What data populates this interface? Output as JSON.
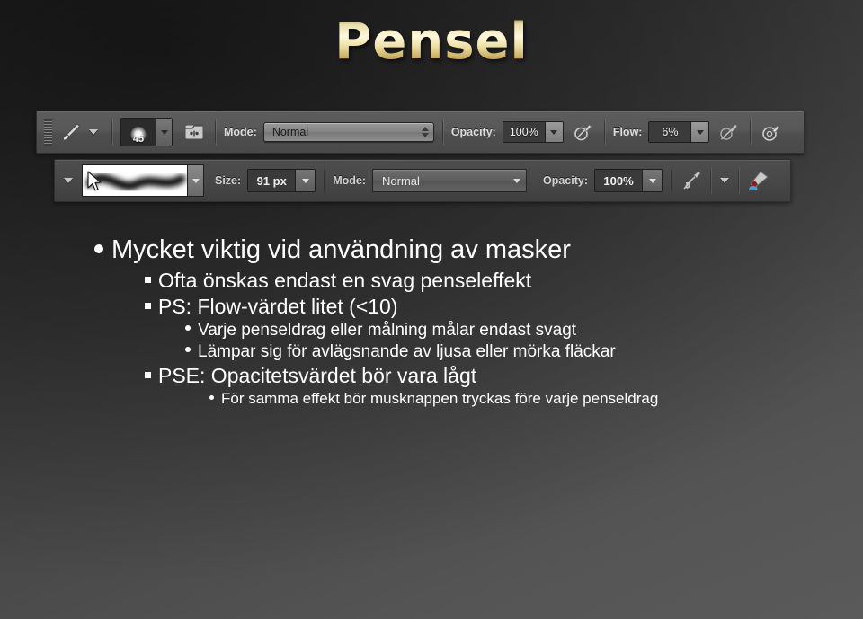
{
  "slide": {
    "title": "Pensel",
    "background_top": "#2a2a2a",
    "background_bottom": "#5a5a5a",
    "title_gradient_light": "#fdf8dc",
    "title_gradient_dark": "#8d7536"
  },
  "toolbar_brush_options": {
    "name": "Photoshop brush tool options bar",
    "grip": "drag-grip",
    "tool_icon": "brush-tool-icon",
    "tool_dropdown": "chevron-down-icon",
    "brush_preset": {
      "size_value": "45",
      "thumb": "soft-round-brush-thumbnail",
      "dropdown": "chevron-down-icon"
    },
    "brush_panel_icon": "brush-panel-toggle-icon",
    "mode": {
      "label": "Mode:",
      "value": "Normal"
    },
    "opacity": {
      "label": "Opacity:",
      "value": "100%"
    },
    "opacity_pressure_icon": "tablet-pressure-opacity-icon",
    "flow": {
      "label": "Flow:",
      "value": "6%"
    },
    "airbrush_icon": "airbrush-disabled-icon",
    "pressure_size_icon": "tablet-pressure-size-icon"
  },
  "toolbar_pse_options": {
    "name": "Photoshop Elements brush options bar",
    "left_dropdown": "chevron-down-icon",
    "stroke_preview": "brush-stroke-preview",
    "cursor": "mouse-pointer-icon",
    "preview_dropdown": "chevron-down-icon",
    "size": {
      "label": "Size:",
      "value": "91 px"
    },
    "mode": {
      "label": "Mode:",
      "value": "Normal"
    },
    "opacity": {
      "label": "Opacity:",
      "value": "100%"
    },
    "tablet_settings_icon": "tablet-settings-icon",
    "tablet_dropdown": "chevron-down-icon",
    "brush_settings_icon": "paintbrush-color-icon"
  },
  "content": {
    "bullets": [
      {
        "level": 1,
        "text": "Mycket viktig vid användning av masker"
      },
      {
        "level": 2,
        "text": "Ofta önskas endast en svag penseleffekt"
      },
      {
        "level": 2,
        "text": "PS: Flow-värdet litet (<10)"
      },
      {
        "level": 3,
        "text": "Varje penseldrag eller målning målar endast svagt"
      },
      {
        "level": 3,
        "text": "Lämpar sig för avlägsnande av ljusa eller mörka fläckar"
      },
      {
        "level": 2,
        "text": "PSE: Opacitetsvärdet bör vara lågt"
      },
      {
        "level": 4,
        "text": "För samma effekt bör musknappen tryckas före varje penseldrag"
      }
    ]
  }
}
